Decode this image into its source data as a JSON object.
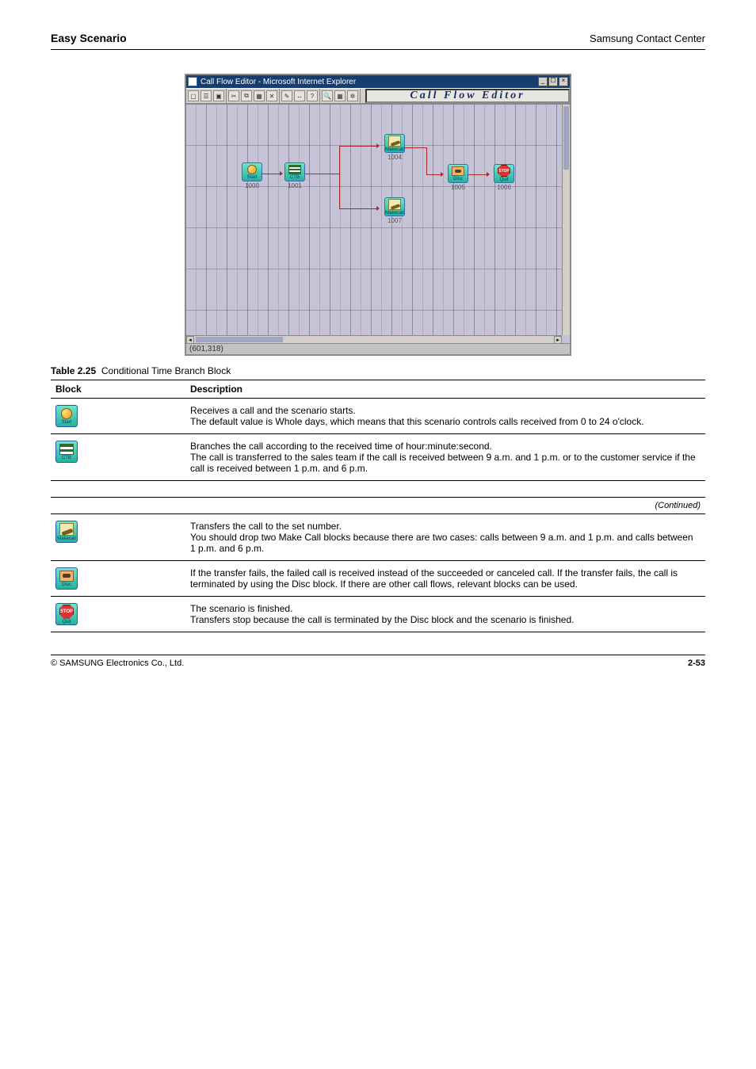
{
  "header": {
    "left": "Easy Scenario",
    "right": "Samsung Contact Center"
  },
  "figure": {
    "window_title": "Call Flow Editor - Microsoft Internet Explorer",
    "banner_title": "Call Flow Editor",
    "status_text": "(601,318)",
    "nodes": {
      "start": {
        "label": "Start",
        "id": "1000"
      },
      "ctb": {
        "label": "CTB",
        "id": "1001"
      },
      "makecall1": {
        "label": "Makecall",
        "id": "1004"
      },
      "makecall2": {
        "label": "Makecall",
        "id": "1007"
      },
      "disc": {
        "label": "Disc",
        "id": "1005"
      },
      "quit": {
        "label": "Quit",
        "id": "1006"
      }
    }
  },
  "legend": {
    "caption_index": "Table 2.25",
    "caption_text": "Conditional Time Branch Block",
    "continued_text": "(Continued)",
    "header_block": "Block",
    "header_desc": "Description",
    "rows": [
      {
        "icon": "start",
        "icon_label": "Start",
        "desc": "Receives a call and the scenario starts.\nThe default value is Whole days, which means that this scenario controls calls received from 0 to 24 o'clock."
      },
      {
        "icon": "ctb",
        "icon_label": "CTB",
        "desc": "Branches the call according to the received time of hour:minute:second.\nThe call is transferred to the sales team if the call is received between 9 a.m. and 1 p.m. or to the customer service if the call is received between 1 p.m. and 6 p.m."
      },
      {
        "icon": "makecall",
        "icon_label": "Makecall",
        "desc": "Transfers the call to the set number.\nYou should drop two Make Call blocks because there are two cases: calls between 9 a.m. and 1 p.m. and calls between 1 p.m. and 6 p.m."
      },
      {
        "icon": "disc",
        "icon_label": "Disc",
        "desc": "If the transfer fails, the failed call is received instead of the succeeded or canceled call. If the transfer fails, the call is terminated by using the Disc block. If there are other call flows, relevant blocks can be used."
      },
      {
        "icon": "quit",
        "icon_label": "Quit",
        "desc": "The scenario is finished.\nTransfers stop because the call is terminated by the Disc block and the scenario is finished."
      }
    ]
  },
  "footer": {
    "copyright": "© SAMSUNG Electronics Co., Ltd.",
    "page": "2-53"
  }
}
